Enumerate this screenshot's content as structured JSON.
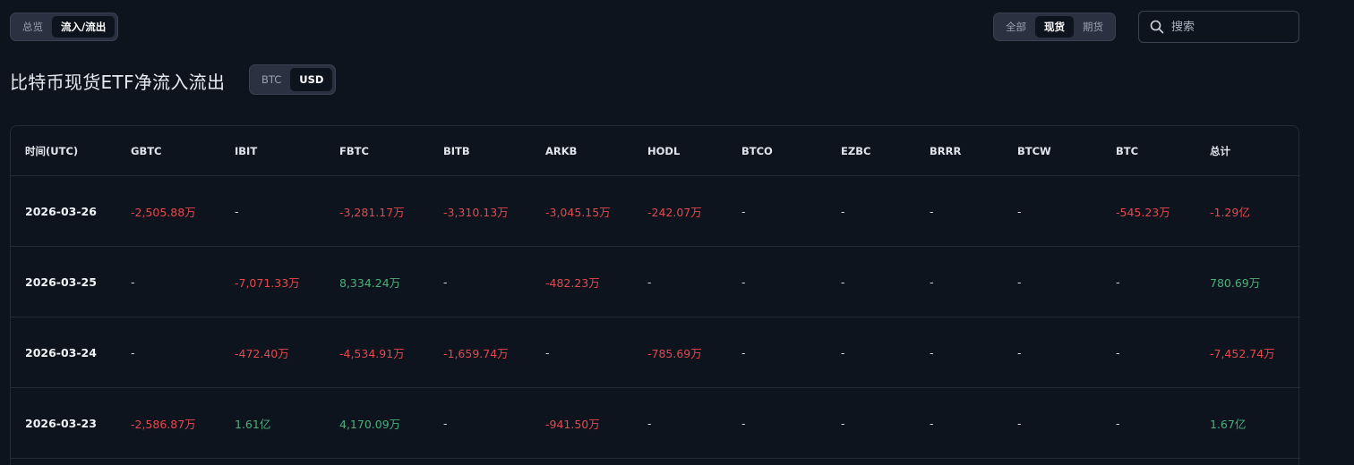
{
  "view_toggle": {
    "options": [
      "总览",
      "流入/流出"
    ],
    "selected": "流入/流出"
  },
  "market_toggle": {
    "options": [
      "全部",
      "现货",
      "期货"
    ],
    "selected": "现货"
  },
  "search": {
    "placeholder": "搜索"
  },
  "title": "比特币现货ETF净流入流出",
  "unit_toggle": {
    "options": [
      "BTC",
      "USD"
    ],
    "selected": "USD"
  },
  "colors": {
    "negative": "#e5484d",
    "positive": "#4caf7a",
    "background": "#0d141e"
  },
  "table": {
    "columns": [
      "时间(UTC)",
      "GBTC",
      "IBIT",
      "FBTC",
      "BITB",
      "ARKB",
      "HODL",
      "BTCO",
      "EZBC",
      "BRRR",
      "BTCW",
      "BTC",
      "总计"
    ],
    "rows": [
      [
        "2026-03-26",
        "-2,505.88万",
        "-",
        "-3,281.17万",
        "-3,310.13万",
        "-3,045.15万",
        "-242.07万",
        "-",
        "-",
        "-",
        "-",
        "-545.23万",
        "-1.29亿"
      ],
      [
        "2026-03-25",
        "-",
        "-7,071.33万",
        "8,334.24万",
        "-",
        "-482.23万",
        "-",
        "-",
        "-",
        "-",
        "-",
        "-",
        "780.69万"
      ],
      [
        "2026-03-24",
        "-",
        "-472.40万",
        "-4,534.91万",
        "-1,659.74万",
        "-",
        "-785.69万",
        "-",
        "-",
        "-",
        "-",
        "-",
        "-7,452.74万"
      ],
      [
        "2026-03-23",
        "-2,586.87万",
        "1.61亿",
        "4,170.09万",
        "-",
        "-941.50万",
        "-",
        "-",
        "-",
        "-",
        "-",
        "-",
        "1.67亿"
      ]
    ]
  }
}
